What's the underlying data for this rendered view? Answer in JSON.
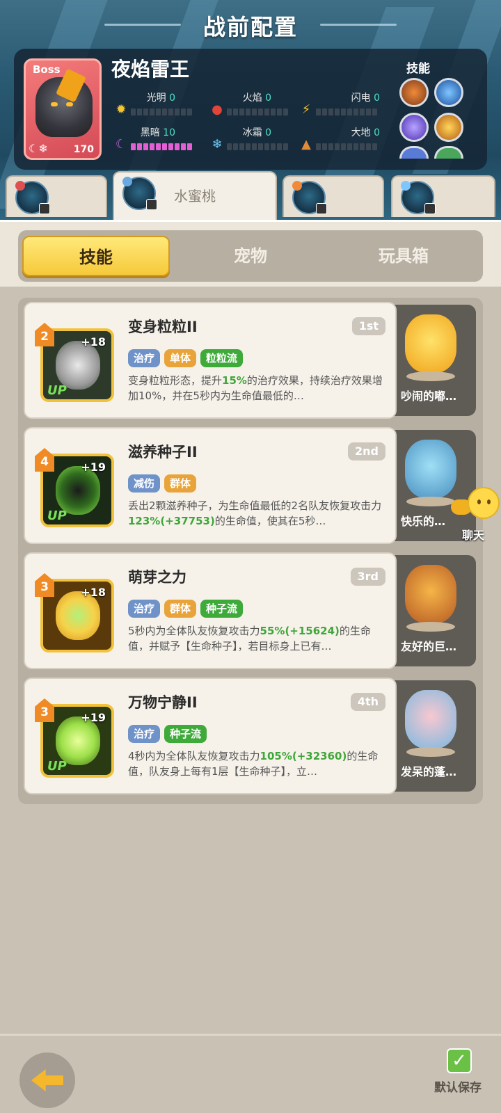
{
  "header": {
    "title": "战前配置"
  },
  "boss": {
    "tag": "Boss",
    "name": "夜焰雷王",
    "level": "170",
    "skills_label": "技能",
    "elements": [
      {
        "name": "光明",
        "value": "0",
        "icon": "sun-icon",
        "color": "#f3c634"
      },
      {
        "name": "火焰",
        "value": "0",
        "icon": "flame-icon",
        "color": "#e0453a"
      },
      {
        "name": "闪电",
        "value": "0",
        "icon": "lightning-icon",
        "color": "#f3c634"
      },
      {
        "name": "黑暗",
        "value": "10",
        "icon": "moon-icon",
        "color": "#c15fd8"
      },
      {
        "name": "冰霜",
        "value": "0",
        "icon": "snowflake-icon",
        "color": "#6cc7f0"
      },
      {
        "name": "大地",
        "value": "0",
        "icon": "mountain-icon",
        "color": "#e08a3a"
      }
    ]
  },
  "hero_tabs": [
    {
      "name": ""
    },
    {
      "name": "水蜜桃"
    },
    {
      "name": ""
    },
    {
      "name": ""
    }
  ],
  "categories": [
    "技能",
    "宠物",
    "玩具箱"
  ],
  "skills": [
    {
      "rank": "2",
      "plus": "+18",
      "up": "UP",
      "title": "变身粒粒II",
      "order": "1st",
      "tags": [
        {
          "text": "治疗",
          "color": "blue"
        },
        {
          "text": "单体",
          "color": "orange"
        },
        {
          "text": "粒粒流",
          "color": "green"
        }
      ],
      "desc_parts": [
        "变身粒粒形态，提升",
        "15%",
        "的治疗效果，持续治疗效果增加10%，并在5秒内为生命值最低的…"
      ],
      "pet_name": "吵闹的嘟…"
    },
    {
      "rank": "4",
      "plus": "+19",
      "up": "UP",
      "title": "滋养种子II",
      "order": "2nd",
      "tags": [
        {
          "text": "减伤",
          "color": "blue"
        },
        {
          "text": "群体",
          "color": "orange"
        }
      ],
      "desc_parts": [
        "丢出2颗滋养种子，为生命值最低的2名队友恢复攻击力",
        "123%(+37753)",
        "的生命值，使其在5秒…"
      ],
      "pet_name": "快乐的…"
    },
    {
      "rank": "3",
      "plus": "+18",
      "up": "",
      "title": "萌芽之力",
      "order": "3rd",
      "tags": [
        {
          "text": "治疗",
          "color": "blue"
        },
        {
          "text": "群体",
          "color": "orange"
        },
        {
          "text": "种子流",
          "color": "green"
        }
      ],
      "desc_parts": [
        "5秒内为全体队友恢复攻击力",
        "55%(+15624)",
        "的生命值，并赋予【生命种子】，若目标身上已有…"
      ],
      "pet_name": "友好的巨…"
    },
    {
      "rank": "3",
      "plus": "+19",
      "up": "UP",
      "title": "万物宁静II",
      "order": "4th",
      "tags": [
        {
          "text": "治疗",
          "color": "blue"
        },
        {
          "text": "种子流",
          "color": "green"
        }
      ],
      "desc_parts": [
        "4秒内为全体队友恢复攻击力",
        "105%(+32360)",
        "的生命值，队友身上每有1层【生命种子】，立…"
      ],
      "pet_name": "发呆的蓬…"
    }
  ],
  "chat": {
    "label": "聊天"
  },
  "footer": {
    "save_label": "默认保存"
  }
}
